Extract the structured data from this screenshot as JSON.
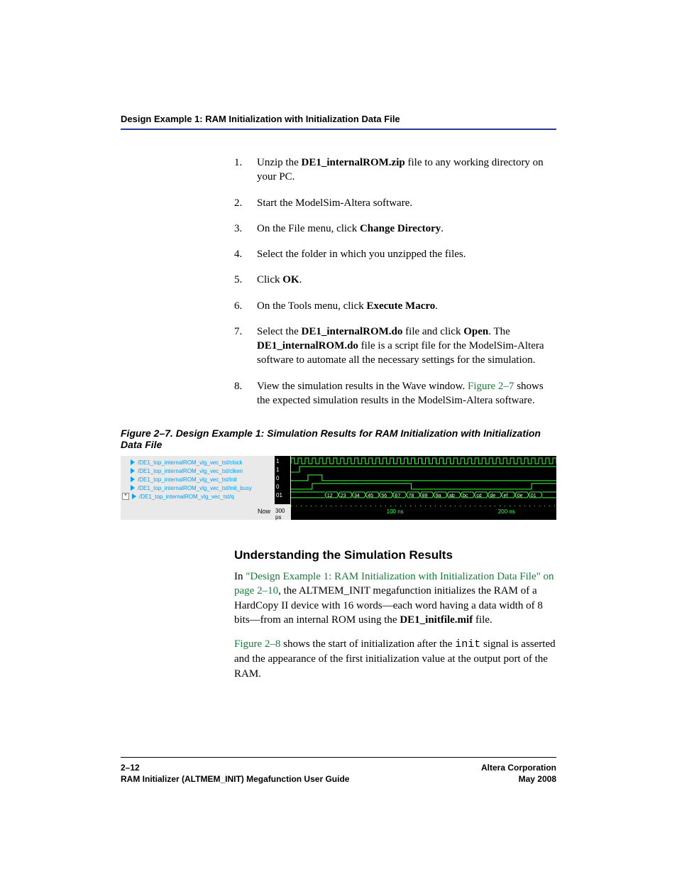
{
  "header": {
    "running": "Design Example 1: RAM Initialization with Initialization Data File"
  },
  "steps": {
    "s1a": "Unzip the ",
    "s1b": "DE1_internalROM.zip",
    "s1c": " file to any working directory on your PC.",
    "s2": "Start the ModelSim-Altera software.",
    "s3a": "On the File menu, click ",
    "s3b": "Change Directory",
    "s3c": ".",
    "s4": "Select the folder in which you unzipped the files.",
    "s5a": "Click ",
    "s5b": "OK",
    "s5c": ".",
    "s6a": "On the Tools menu, click ",
    "s6b": "Execute Macro",
    "s6c": ".",
    "s7a": "Select the ",
    "s7b": "DE1_internalROM.do",
    "s7c": " file and click ",
    "s7d": "Open",
    "s7e": ". The ",
    "s7f": "DE1_internalROM.do",
    "s7g": " file is a script file for the ModelSim-Altera software to automate all the necessary settings for the simulation.",
    "s8a": "View the simulation results in the Wave window. ",
    "s8b": "Figure 2–7",
    "s8c": " shows the expected simulation results in the ModelSim-Altera software."
  },
  "figure": {
    "caption": "Figure 2–7. Design Example 1: Simulation Results for RAM Initialization with Initialization Data File"
  },
  "wave": {
    "signals": [
      {
        "name": "/DE1_top_internalROM_vlg_vec_tst/clock",
        "value": "1"
      },
      {
        "name": "/DE1_top_internalROM_vlg_vec_tst/clken",
        "value": "1"
      },
      {
        "name": "/DE1_top_internalROM_vlg_vec_tst/init",
        "value": "0"
      },
      {
        "name": "/DE1_top_internalROM_vlg_vec_tst/init_busy",
        "value": "0"
      },
      {
        "name": "/DE1_top_internalROM_vlg_vec_tst/q",
        "value": "01"
      }
    ],
    "now_label": "Now",
    "now_value": "300 ps",
    "bus_values": [
      "12",
      "23",
      "34",
      "45",
      "56",
      "67",
      "78",
      "89",
      "9a",
      "ab",
      "bc",
      "cd",
      "de",
      "ef",
      "0e",
      "01"
    ],
    "ruler": [
      {
        "label": "100 ns",
        "pos_pct": 36
      },
      {
        "label": "200 ns",
        "pos_pct": 78
      }
    ]
  },
  "section": {
    "heading": "Understanding the Simulation Results",
    "p1a": "In ",
    "p1b": "\"Design Example 1: RAM Initialization with Initialization Data File\" on page 2–10",
    "p1c": ", the ALTMEM_INIT megafunction initializes the RAM of a HardCopy II device with 16 words—each word having a data width of 8 bits—from an internal ROM using the ",
    "p1d": "DE1_initfile.mif",
    "p1e": " file.",
    "p2a": "Figure 2–8",
    "p2b": " shows the start of initialization after the ",
    "p2c": "init",
    "p2d": " signal is asserted and the appearance of the first initialization value at the output port of the RAM."
  },
  "footer": {
    "page": "2–12",
    "doc": "RAM Initializer (ALTMEM_INIT) Megafunction User Guide",
    "corp": "Altera Corporation",
    "date": "May 2008"
  }
}
